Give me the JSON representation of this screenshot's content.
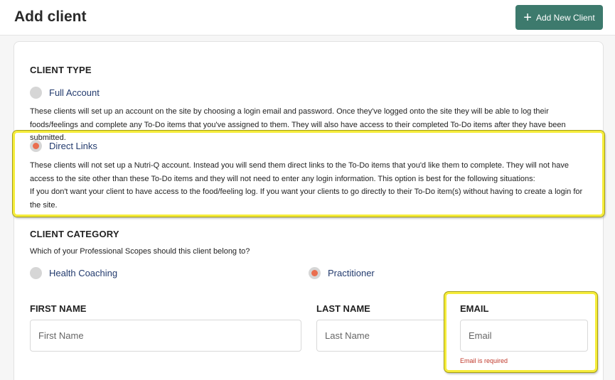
{
  "header": {
    "title": "Add client",
    "add_button_label": "Add New Client"
  },
  "client_type": {
    "heading": "CLIENT TYPE",
    "options": [
      {
        "label": "Full Account",
        "selected": false,
        "description": "These clients will set up an account on the site by choosing a login email and password. Once they've logged onto the site they will be able to log their foods/feelings and complete any To-Do items that you've assigned to them. They will also have access to their completed To-Do items after they have been submitted."
      },
      {
        "label": "Direct Links",
        "selected": true,
        "description": "These clients will not set up a Nutri-Q account. Instead you will send them direct links to the To-Do items that you'd like them to complete. They will not have access to the site other than these To-Do items and they will not need to enter any login information. This option is best for the following situations:",
        "description_2": "If you don't want your client to have access to the food/feeling log. If you want your clients to go directly to their To-Do item(s) without having to create a login for the site."
      }
    ]
  },
  "client_category": {
    "heading": "CLIENT CATEGORY",
    "question": "Which of your Professional Scopes should this client belong to?",
    "options": [
      {
        "label": "Health Coaching",
        "selected": false
      },
      {
        "label": "Practitioner",
        "selected": true
      }
    ]
  },
  "form": {
    "first_name": {
      "label": "FIRST NAME",
      "placeholder": "First Name"
    },
    "last_name": {
      "label": "LAST NAME",
      "placeholder": "Last Name"
    },
    "email": {
      "label": "EMAIL",
      "placeholder": "Email",
      "error": "Email is required"
    }
  },
  "colors": {
    "accent": "#3d7a6d",
    "radio_selected": "#ea6e4f",
    "highlight": "#f5ec3a",
    "error": "#c0392b"
  }
}
